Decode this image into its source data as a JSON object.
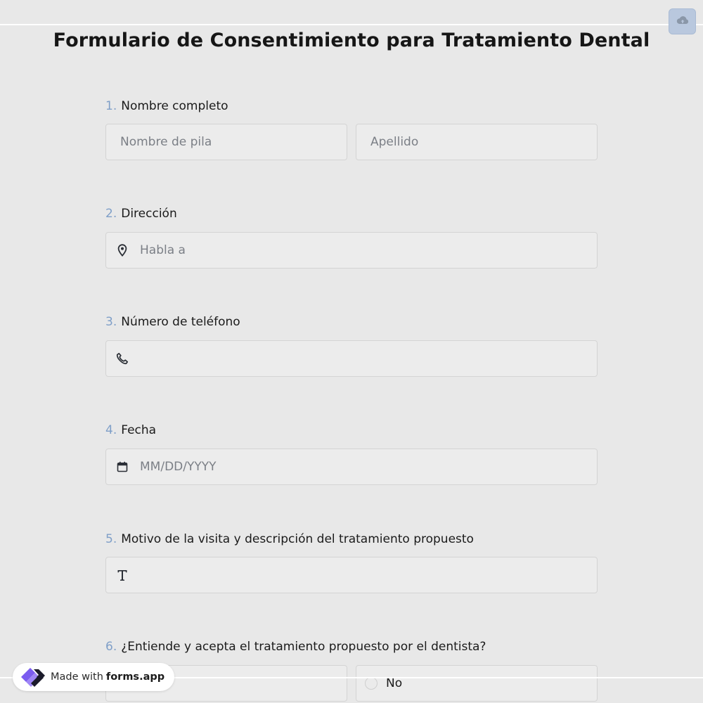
{
  "form": {
    "title": "Formulario de Consentimiento para Tratamiento Dental",
    "save_icon": "cloud-upload-icon"
  },
  "questions": [
    {
      "number": "1.",
      "label": "Nombre completo",
      "first_name_placeholder": "Nombre de pila",
      "last_name_placeholder": "Apellido"
    },
    {
      "number": "2.",
      "label": "Dirección",
      "placeholder": "Habla a",
      "icon": "map-pin-icon"
    },
    {
      "number": "3.",
      "label": "Número de teléfono",
      "placeholder": "",
      "icon": "phone-icon"
    },
    {
      "number": "4.",
      "label": "Fecha",
      "placeholder": "MM/DD/YYYY",
      "icon": "calendar-icon"
    },
    {
      "number": "5.",
      "label": "Motivo de la visita y descripción del tratamiento propuesto",
      "placeholder": "",
      "icon": "text-icon"
    },
    {
      "number": "6.",
      "label": "¿Entiende y acepta el tratamiento propuesto por el dentista?",
      "options": [
        "",
        "No"
      ]
    }
  ],
  "badge": {
    "made_with": "Made with",
    "brand": "forms.app"
  },
  "colors": {
    "background": "#e8e8e8",
    "number_accent": "#7f9fc8",
    "save_button": "#b9c8de",
    "logo_purple": "#7b5cf0",
    "logo_dark": "#1b1b2b"
  }
}
